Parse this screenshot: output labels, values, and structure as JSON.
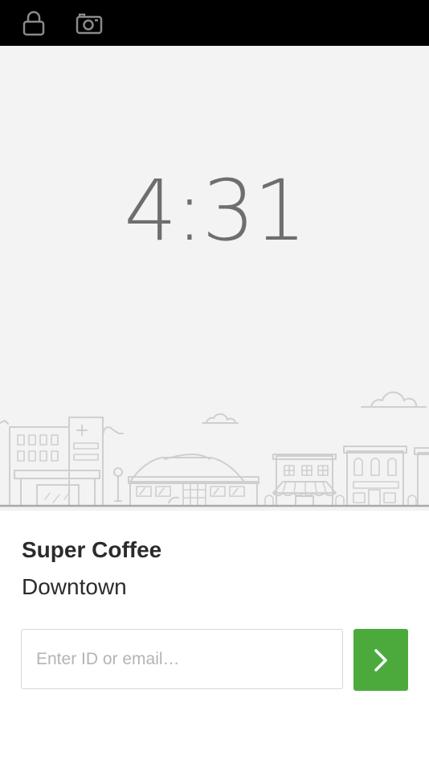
{
  "status_bar": {
    "lock_icon": "lock-icon",
    "camera_icon": "camera-icon"
  },
  "clock": {
    "time": "4:31"
  },
  "location_info": {
    "business_name": "Super Coffee",
    "location_name": "Downtown"
  },
  "sign_in": {
    "placeholder": "Enter ID or email…",
    "value": "",
    "submit_icon": "chevron-right-icon"
  },
  "colors": {
    "accent_green": "#4caa3d",
    "top_bar": "#000000",
    "clock_background": "#f3f3f3",
    "clock_text": "#6e6e6e"
  }
}
